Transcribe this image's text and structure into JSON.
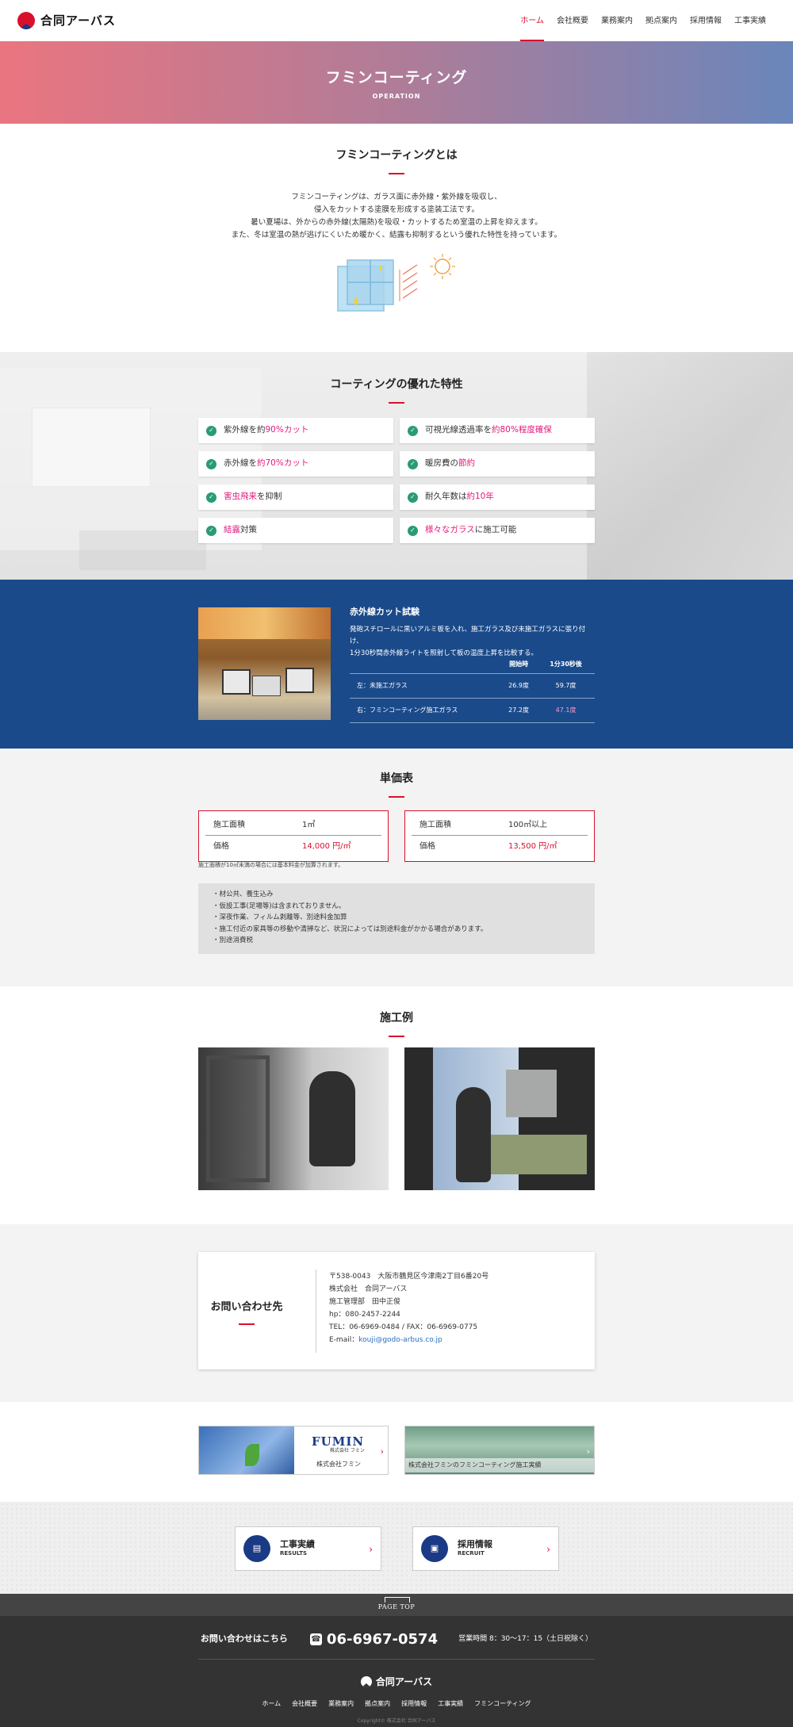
{
  "header": {
    "logo_text": "合同アーバス",
    "nav": [
      "ホーム",
      "会社概要",
      "業務案内",
      "拠点案内",
      "採用情報",
      "工事実績"
    ]
  },
  "hero": {
    "title": "フミンコーティング",
    "subtitle": "OPERATION"
  },
  "about": {
    "title": "フミンコーティングとは",
    "lines": [
      "フミンコーティングは、ガラス面に赤外線・紫外線を吸収し、",
      "侵入をカットする塗膜を形成する塗装工法です。",
      "暑い夏場は、外からの赤外線(太陽熱)を吸収・カットするため室温の上昇を抑えます。",
      "また、冬は室温の熱が逃げにくいため暖かく、結露も抑制するという優れた特性を持っています。"
    ]
  },
  "features": {
    "title": "コーティングの優れた特性",
    "items": [
      {
        "a": "紫外線を約",
        "b": "90%カット",
        "c": ""
      },
      {
        "a": "可視光線透過率を",
        "b": "約80%程度確保",
        "c": ""
      },
      {
        "a": "赤外線を",
        "b": "約70%カット",
        "c": ""
      },
      {
        "a": "暖房費の",
        "b": "節約",
        "c": ""
      },
      {
        "a": "",
        "b": "害虫飛来",
        "c": "を抑制"
      },
      {
        "a": "耐久年数は",
        "b": "約10年",
        "c": ""
      },
      {
        "a": "",
        "b": "結露",
        "c": "対策"
      },
      {
        "a": "",
        "b": "様々なガラス",
        "c": "に施工可能"
      }
    ]
  },
  "test": {
    "title": "赤外線カット試験",
    "desc_lines": [
      "発砲スチロールに黒いアルミ板を入れ、施工ガラス及び未施工ガラスに張り付け、",
      "1分30秒間赤外線ライトを照射して板の温度上昇を比較する。"
    ],
    "headers": [
      "",
      "開始時",
      "1分30秒後"
    ],
    "rows": [
      {
        "label": "左：未施工ガラス",
        "start": "26.9度",
        "after": "59.7度"
      },
      {
        "label": "右：フミンコーティング施工ガラス",
        "start": "27.2度",
        "after": "47.1度"
      }
    ]
  },
  "price": {
    "title": "単価表",
    "boxes": [
      {
        "area_label": "施工面積",
        "area": "1㎡",
        "price_label": "価格",
        "price": "14,000 円/㎡"
      },
      {
        "area_label": "施工面積",
        "area": "100㎡以上",
        "price_label": "価格",
        "price": "13,500 円/㎡"
      }
    ],
    "note": "施工面積が10㎡未満の場合には基本料金が加算されます。",
    "list": [
      "・材公共、養生込み",
      "・仮設工事(足場等)は含まれておりません。",
      "・深夜作業、フィルム剥離等、別途料金加算",
      "・施工付近の家具等の移動や清掃など、状況によっては別途料金がかかる場合があります。",
      "・別途消費税"
    ]
  },
  "examples": {
    "title": "施工例"
  },
  "contact": {
    "title": "お問い合わせ先",
    "lines": [
      "〒538-0043　大阪市鶴見区今津南2丁目6番20号",
      "株式会社　合同アーバス",
      "施工管理部　田中正俊",
      "hp：080-2457-2244",
      "TEL：06-6969-0484 / FAX：06-6969-0775"
    ],
    "email_label": "E-mail：",
    "email": "kouji@godo-arbus.co.jp"
  },
  "banners": {
    "fumin_brand": "FUMIN",
    "fumin_sub": "株式会社 フミン",
    "fumin_caption": "株式会社フミン",
    "coating_caption": "株式会社フミンのフミンコーティング施工実績"
  },
  "links": [
    {
      "title": "工事実績",
      "sub": "RESULTS"
    },
    {
      "title": "採用情報",
      "sub": "RECRUIT"
    }
  ],
  "footer": {
    "page_top": "PAGE TOP",
    "contact_label": "お問い合わせはこちら",
    "tel": "06-6967-0574",
    "hours": "営業時間 8：30〜17：15（土日祝除く）",
    "logo_text": "合同アーバス",
    "nav": [
      "ホーム",
      "会社概要",
      "業務案内",
      "拠点案内",
      "採用情報",
      "工事実績",
      "フミンコーティング"
    ],
    "copyright": "Copyright© 株式会社 合同アーバス"
  },
  "colors": {
    "accent": "#d9102c",
    "navy": "#1a4a8a",
    "check": "#2a9b72",
    "highlight": "#e5197c"
  }
}
